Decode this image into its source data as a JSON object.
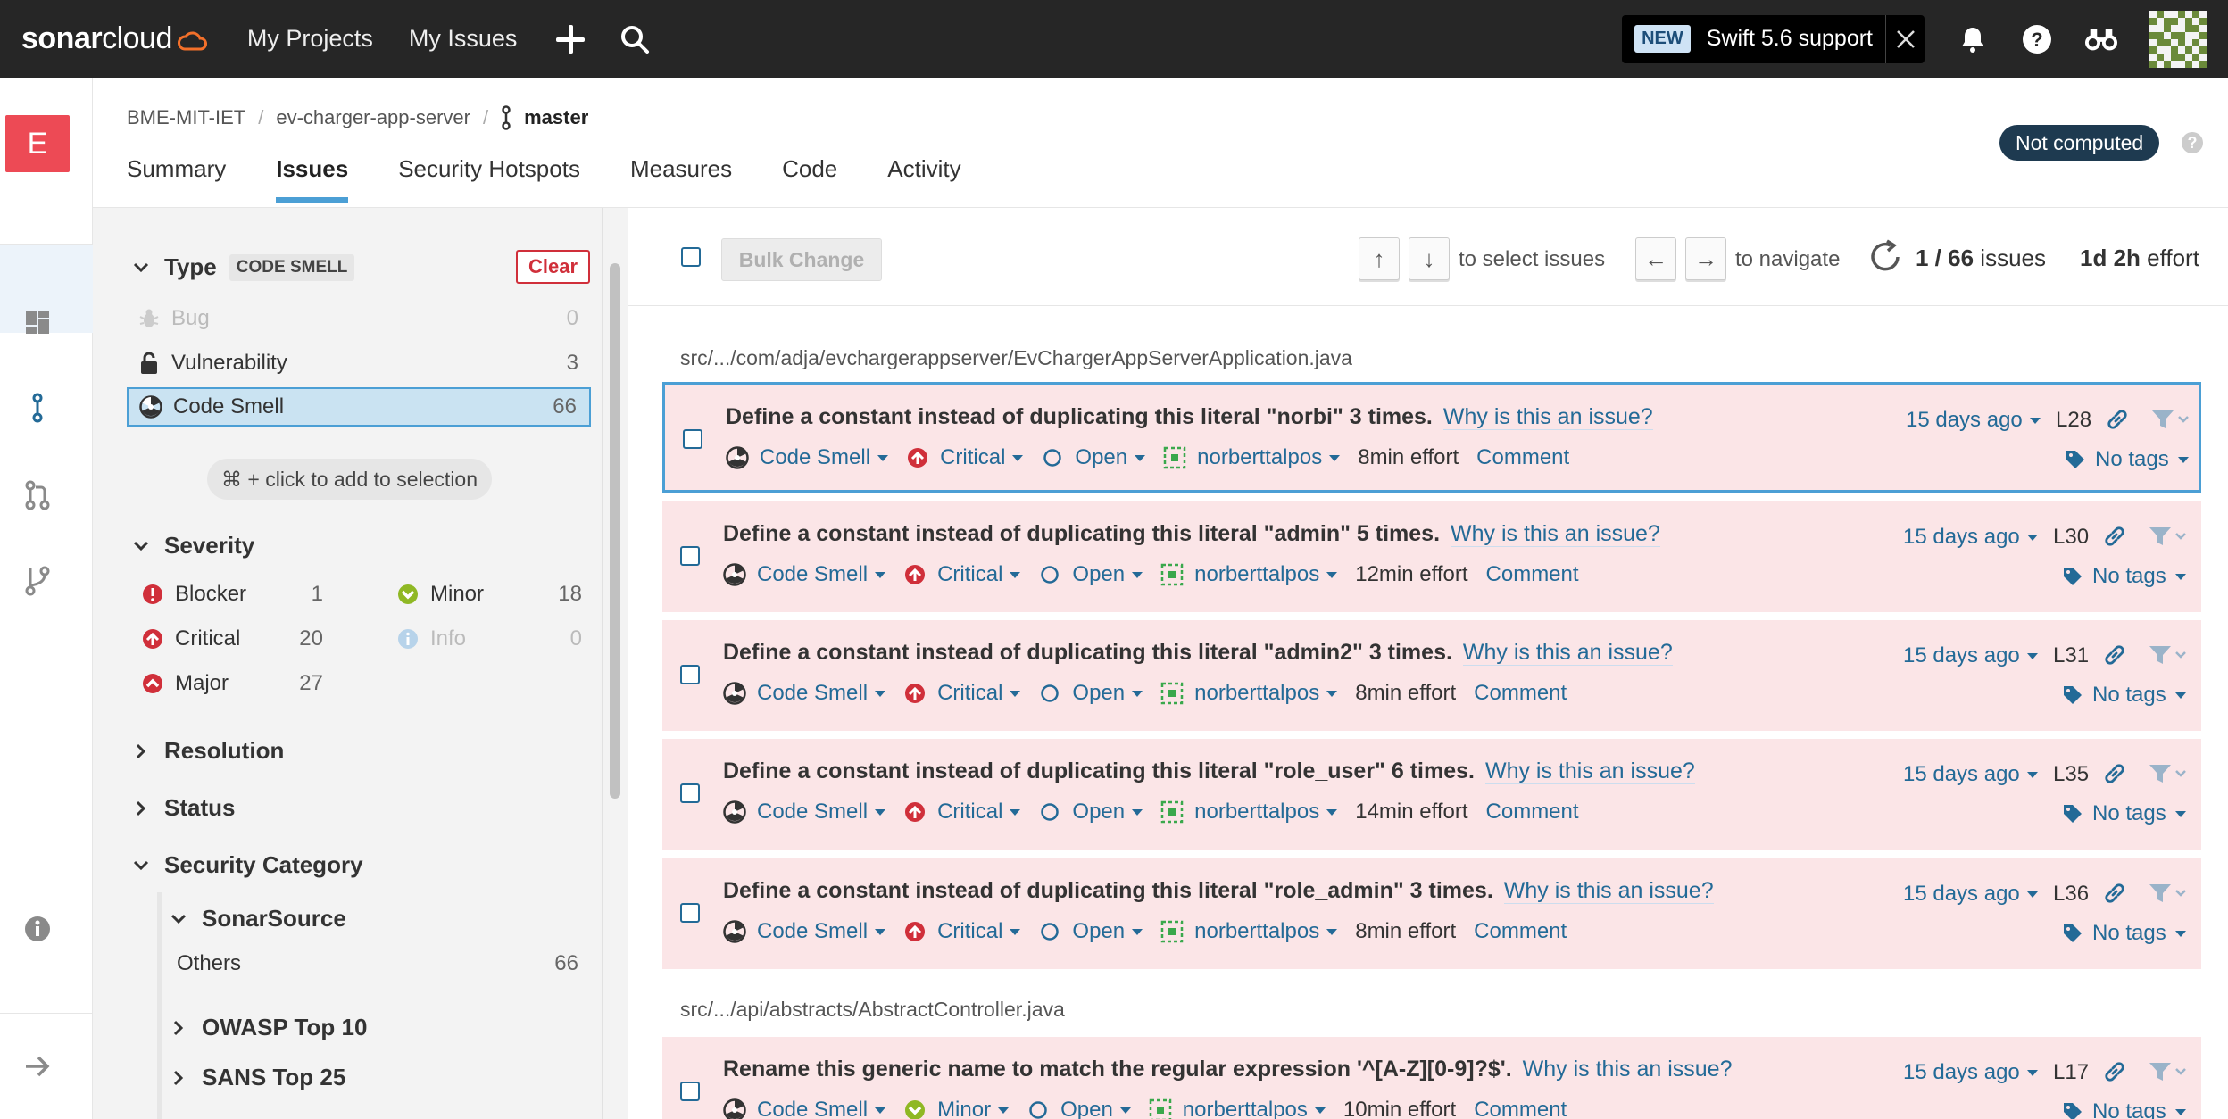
{
  "topbar": {
    "logo_bold": "sonar",
    "logo_light": "cloud",
    "nav": [
      "My Projects",
      "My Issues"
    ],
    "news_badge": "NEW",
    "news_text": "Swift 5.6 support"
  },
  "rail": {
    "org_letter": "E"
  },
  "breadcrumb": {
    "org": "BME-MIT-IET",
    "project": "ev-charger-app-server",
    "branch": "master"
  },
  "tabs": [
    "Summary",
    "Issues",
    "Security Hotspots",
    "Measures",
    "Code",
    "Activity"
  ],
  "active_tab": "Issues",
  "quality_gate": "Not computed",
  "filters": {
    "type": {
      "title": "Type",
      "badge": "CODE SMELL",
      "clear": "Clear",
      "items": [
        {
          "label": "Bug",
          "count": "0"
        },
        {
          "label": "Vulnerability",
          "count": "3"
        },
        {
          "label": "Code Smell",
          "count": "66"
        }
      ],
      "hint": "⌘ + click to add to selection"
    },
    "severity": {
      "title": "Severity",
      "items": [
        {
          "label": "Blocker",
          "count": "1"
        },
        {
          "label": "Critical",
          "count": "20"
        },
        {
          "label": "Major",
          "count": "27"
        },
        {
          "label": "Minor",
          "count": "18"
        },
        {
          "label": "Info",
          "count": "0"
        }
      ]
    },
    "resolution": "Resolution",
    "status": "Status",
    "security_category": {
      "title": "Security Category",
      "sonarsource": "SonarSource",
      "others_label": "Others",
      "others_count": "66",
      "owasp": "OWASP Top 10",
      "sans": "SANS Top 25"
    }
  },
  "toolbar": {
    "bulk_change": "Bulk Change",
    "select_text": "to select issues",
    "navigate_text": "to navigate",
    "issue_position": "1 / 66",
    "issues_word": "issues",
    "effort_value": "1d 2h",
    "effort_word": "effort",
    "up": "↑",
    "down": "↓",
    "left": "←",
    "right": "→"
  },
  "files": [
    "src/.../com/adja/evchargerappserver/EvChargerAppServerApplication.java",
    "src/.../api/abstracts/AbstractController.java"
  ],
  "issue_common": {
    "why": "Why is this an issue?",
    "status": "Open",
    "assignee": "norberttalpos",
    "comment": "Comment",
    "tags": "No tags",
    "ago": "15 days ago"
  },
  "issues": [
    {
      "message": "Define a constant instead of duplicating this literal \"norbi\" 3 times.",
      "type": "Code Smell",
      "severity": "Critical",
      "effort": "8min effort",
      "line": "L28"
    },
    {
      "message": "Define a constant instead of duplicating this literal \"admin\" 5 times.",
      "type": "Code Smell",
      "severity": "Critical",
      "effort": "12min effort",
      "line": "L30"
    },
    {
      "message": "Define a constant instead of duplicating this literal \"admin2\" 3 times.",
      "type": "Code Smell",
      "severity": "Critical",
      "effort": "8min effort",
      "line": "L31"
    },
    {
      "message": "Define a constant instead of duplicating this literal \"role_user\" 6 times.",
      "type": "Code Smell",
      "severity": "Critical",
      "effort": "14min effort",
      "line": "L35"
    },
    {
      "message": "Define a constant instead of duplicating this literal \"role_admin\" 3 times.",
      "type": "Code Smell",
      "severity": "Critical",
      "effort": "8min effort",
      "line": "L36"
    },
    {
      "message": "Rename this generic name to match the regular expression '^[A-Z][0-9]?$'.",
      "type": "Code Smell",
      "severity": "Minor",
      "effort": "10min effort",
      "line": "L17"
    }
  ],
  "colors": {
    "accent": "#4b9fd5",
    "link": "#236a97",
    "critical": "#d02f3a",
    "minor": "#8fb824",
    "issue_bg": "#fbe5e7"
  }
}
